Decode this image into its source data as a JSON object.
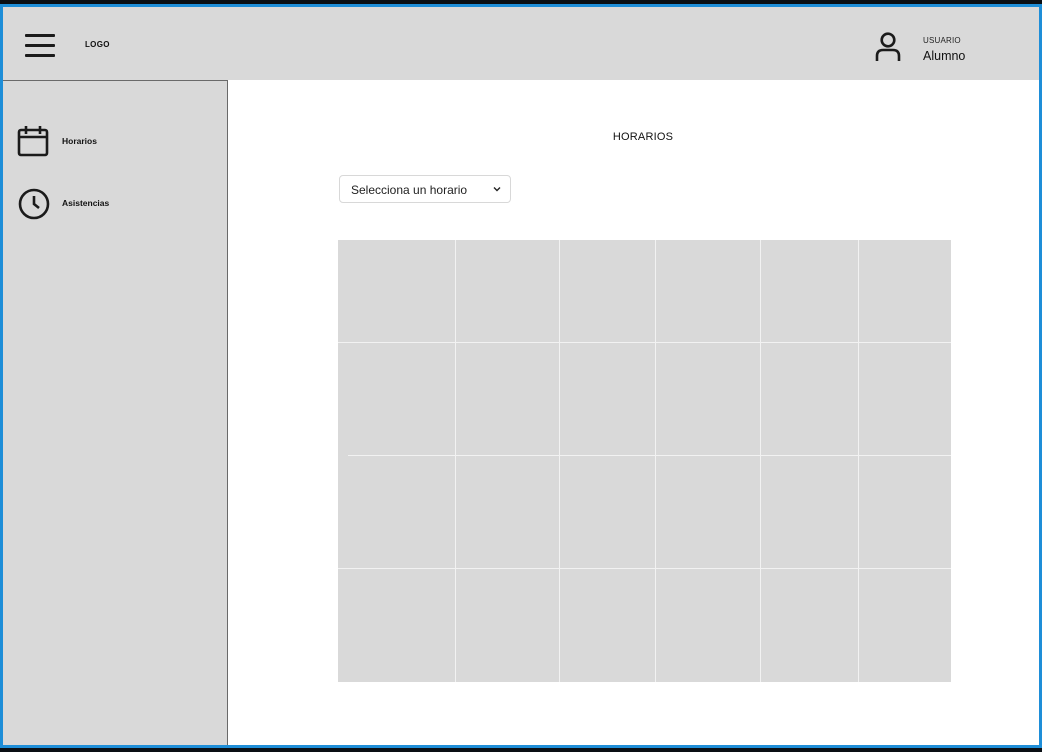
{
  "header": {
    "menu_icon": "hamburger-menu-icon",
    "logo": "LOGO",
    "user": {
      "icon": "user-icon",
      "label": "USUARIO",
      "name": "Alumno"
    }
  },
  "sidebar": {
    "items": [
      {
        "label": "Horarios",
        "icon": "calendar-icon"
      },
      {
        "label": "Asistencias",
        "icon": "clock-icon"
      }
    ]
  },
  "main": {
    "title": "HORARIOS",
    "select": {
      "value": "Selecciona un horario",
      "icon": "chevron-down-icon"
    },
    "schedule_grid": {
      "columns": 6,
      "rows": 4
    }
  },
  "colors": {
    "panel_gray": "#d9d9d9",
    "frame_blue": "#1e8ed8",
    "background": "#ffffff"
  }
}
